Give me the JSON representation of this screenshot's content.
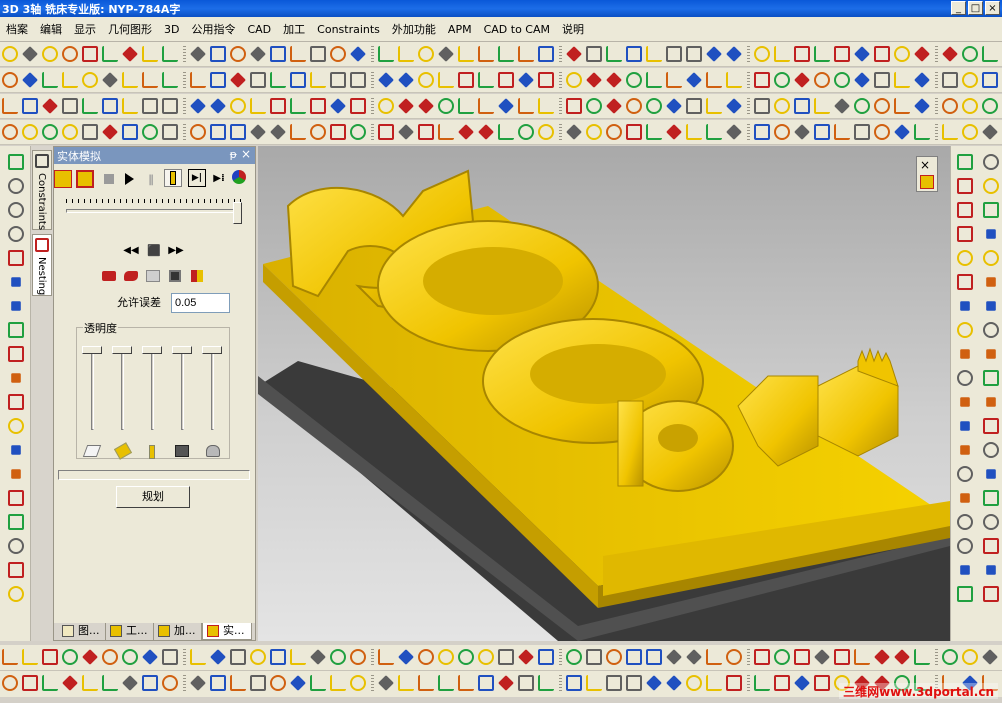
{
  "window": {
    "title": "3D 3轴 铣床专业版: NYP-784A字",
    "buttons": [
      "_",
      "□",
      "×"
    ]
  },
  "menu": [
    "档案",
    "编辑",
    "显示",
    "几何图形",
    "3D",
    "公用指令",
    "CAD",
    "加工",
    "Constraints",
    "外加功能",
    "APM",
    "CAD to CAM",
    "说明"
  ],
  "side_tabs": {
    "constraints": "Constraints",
    "nesting": "Nesting"
  },
  "panel": {
    "title": "实体模拟",
    "pin": "ᵽ",
    "close": "×",
    "tolerance_label": "允许误差",
    "tolerance_value": "0.05",
    "transparency_label": "透明度",
    "plan_button": "规划",
    "speed_level": 1.0,
    "transparency_levels": [
      1.0,
      1.0,
      1.0,
      1.0,
      1.0
    ],
    "progress": 0,
    "bottom_tabs": [
      "图...",
      "工...",
      "加...",
      "实..."
    ],
    "active_tab_index": 3
  },
  "viewport": {
    "close": "×",
    "model_color": "#f2c800",
    "model_shadow": "#b89400",
    "base_color": "#3a3a3a"
  },
  "watermark": "三维网www.3dportal.cn",
  "colors": {
    "title_bar": "#0a58d8",
    "chrome": "#ece9d8",
    "icon_red": "#c02020",
    "icon_yellow": "#e8c000"
  }
}
